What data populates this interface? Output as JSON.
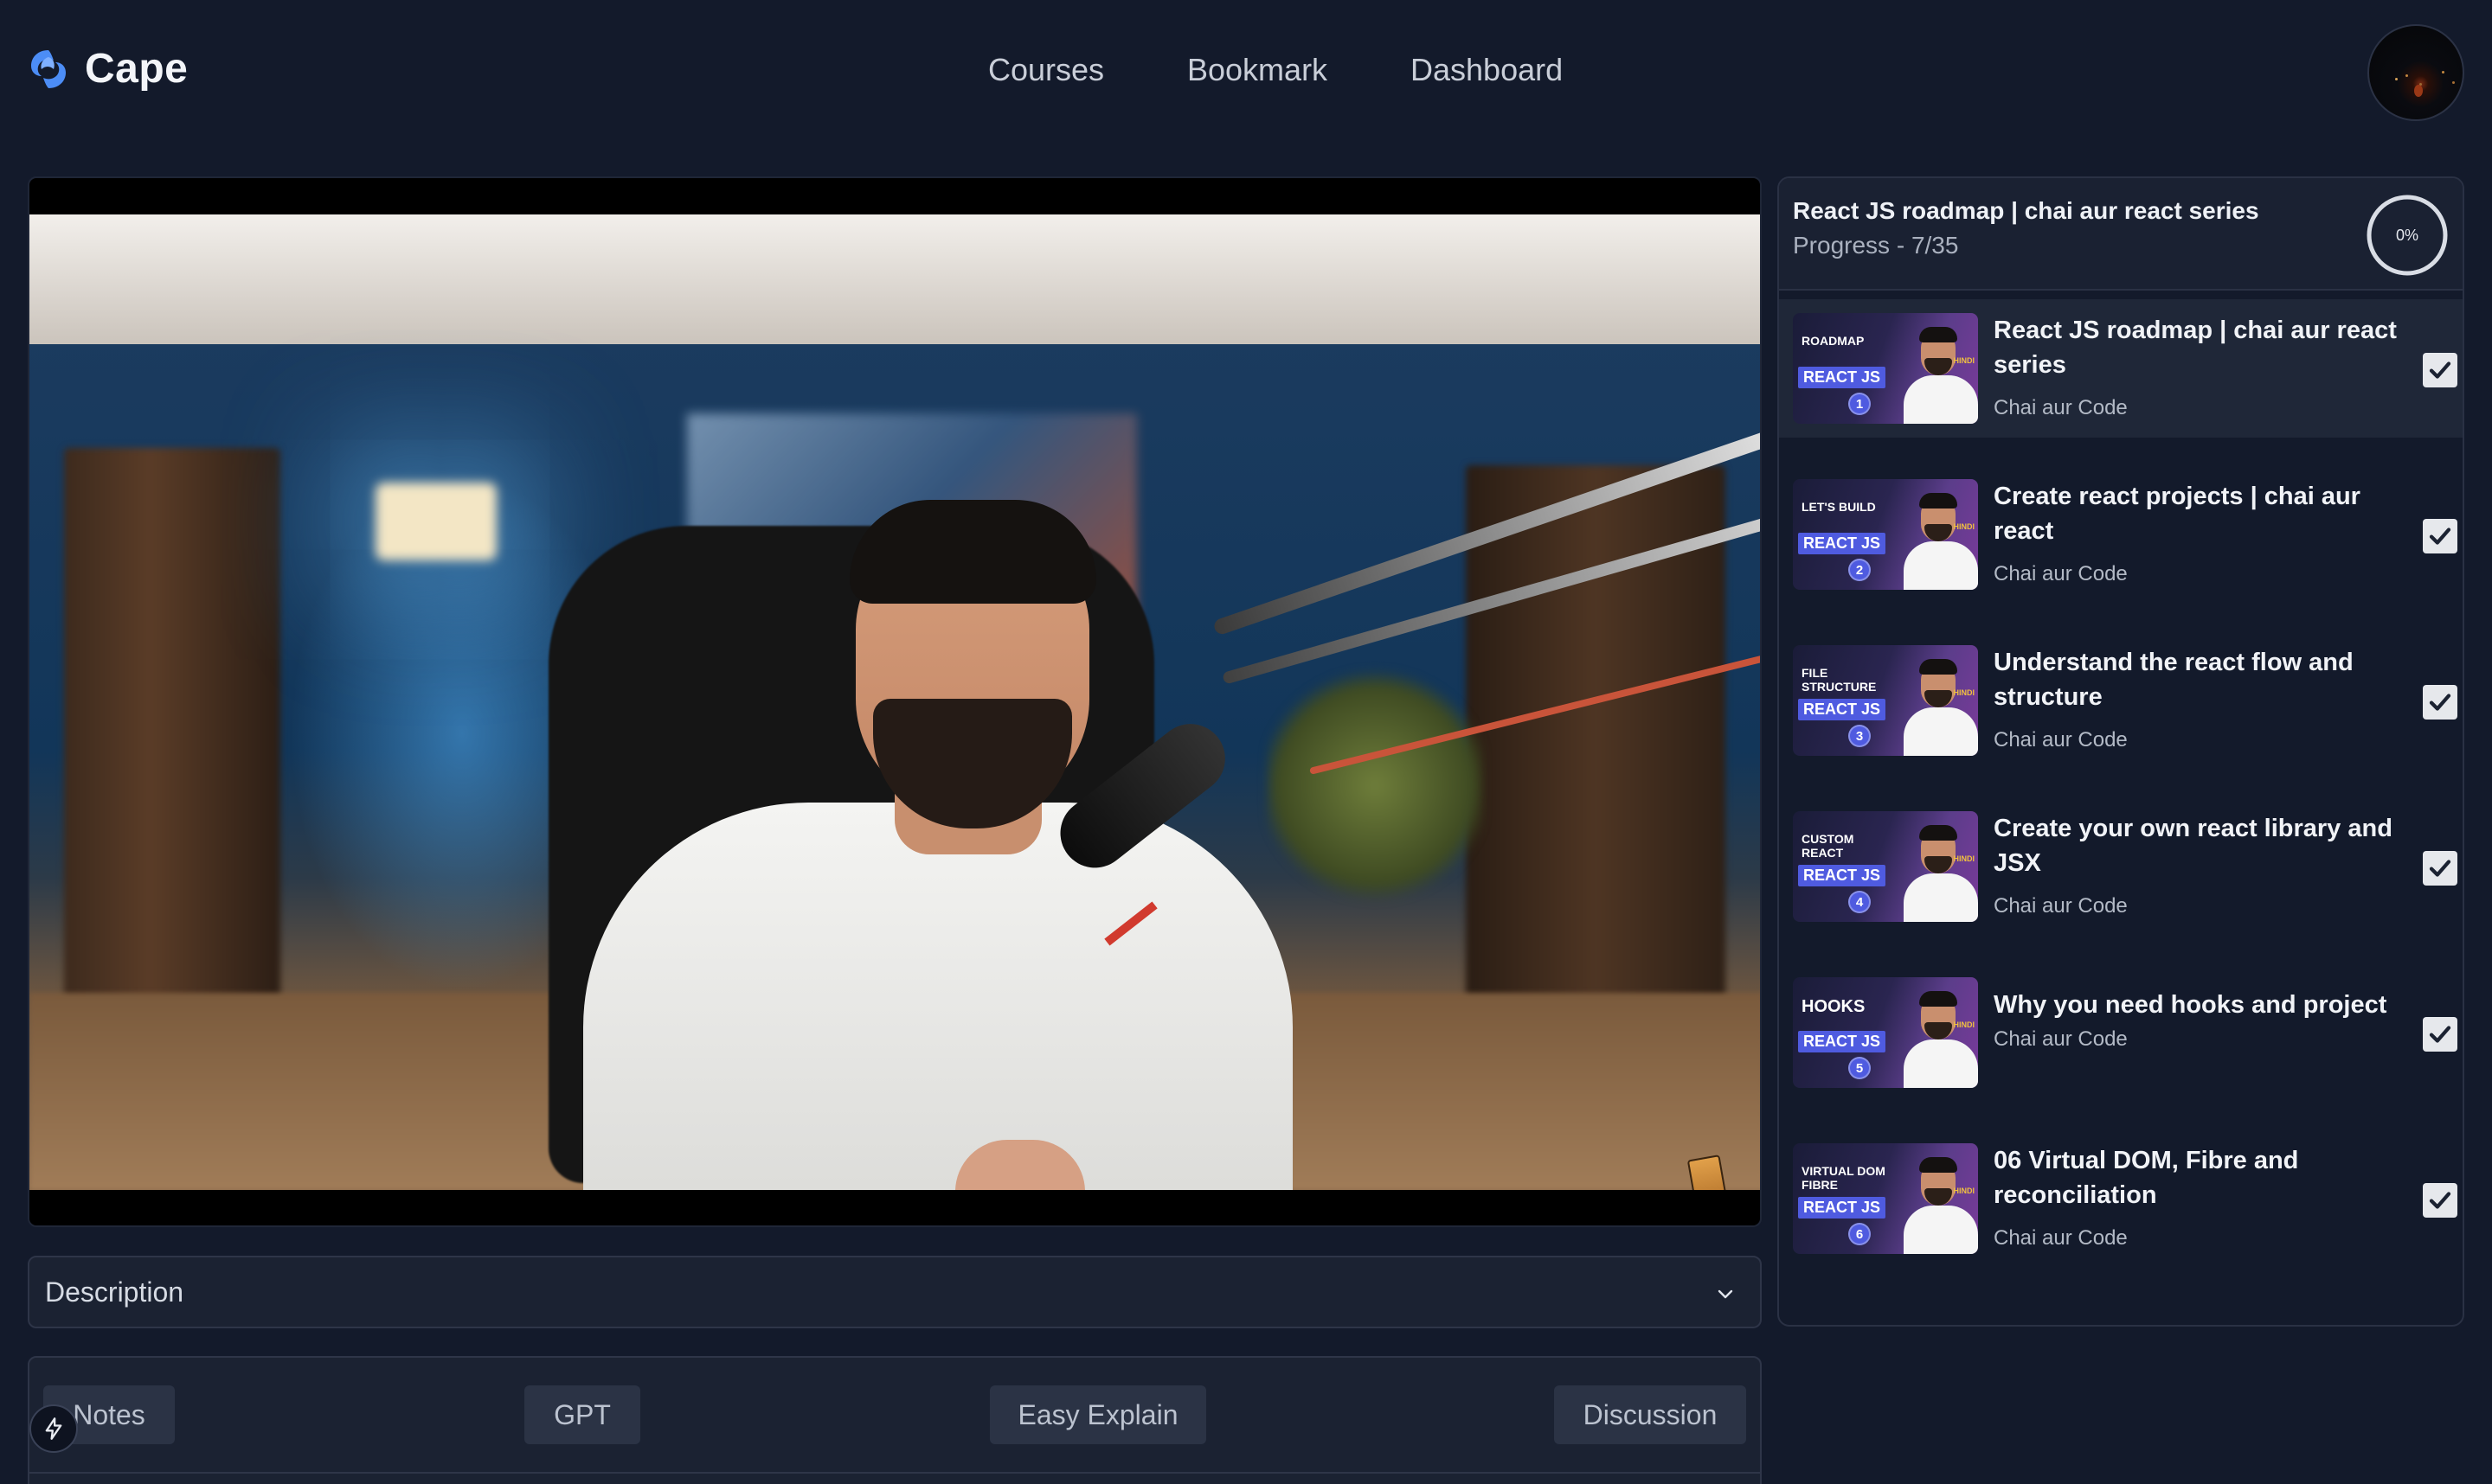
{
  "header": {
    "brand": "Cape",
    "nav": [
      "Courses",
      "Bookmark",
      "Dashboard"
    ]
  },
  "video": {
    "watermark_icon": "chai-cup-icon"
  },
  "description": {
    "label": "Description"
  },
  "tabs": [
    "Notes",
    "GPT",
    "Easy Explain",
    "Discussion"
  ],
  "playlist": {
    "title": "React JS roadmap | chai aur react series",
    "progress_label": "Progress -",
    "progress_count": "7/35",
    "progress_percent": "0%",
    "progress_fraction": 0,
    "items": [
      {
        "thumb_label": "ROADMAP",
        "badge": "REACT JS",
        "num": "1",
        "hindi": "HINDI",
        "title": "React JS roadmap | chai aur react series",
        "channel": "Chai aur Code",
        "checked": true
      },
      {
        "thumb_label": "LET'S BUILD",
        "badge": "REACT JS",
        "num": "2",
        "hindi": "HINDI",
        "title": "Create react projects | chai aur react",
        "channel": "Chai aur Code",
        "checked": true
      },
      {
        "thumb_label": "FILE STRUCTURE",
        "badge": "REACT JS",
        "num": "3",
        "hindi": "HINDI",
        "title": "Understand the react flow and structure",
        "channel": "Chai aur Code",
        "checked": true
      },
      {
        "thumb_label": "CUSTOM REACT",
        "badge": "REACT JS",
        "num": "4",
        "hindi": "HINDI",
        "title": "Create your own react library and JSX",
        "channel": "Chai aur Code",
        "checked": true
      },
      {
        "thumb_label": "HOOKS",
        "badge": "REACT JS",
        "num": "5",
        "hindi": "HINDI",
        "title": "Why you need hooks and project",
        "channel": "Chai aur Code",
        "checked": true
      },
      {
        "thumb_label": "VIRTUAL DOM FIBRE",
        "badge": "REACT JS",
        "num": "6",
        "hindi": "HINDI",
        "title": "06 Virtual DOM, Fibre and reconciliation",
        "channel": "Chai aur Code",
        "checked": true
      }
    ]
  },
  "colors": {
    "background": "#131a2b",
    "panel": "#1b2232",
    "accent": "#4f5be0",
    "brand_logo": "#3b82f6"
  }
}
